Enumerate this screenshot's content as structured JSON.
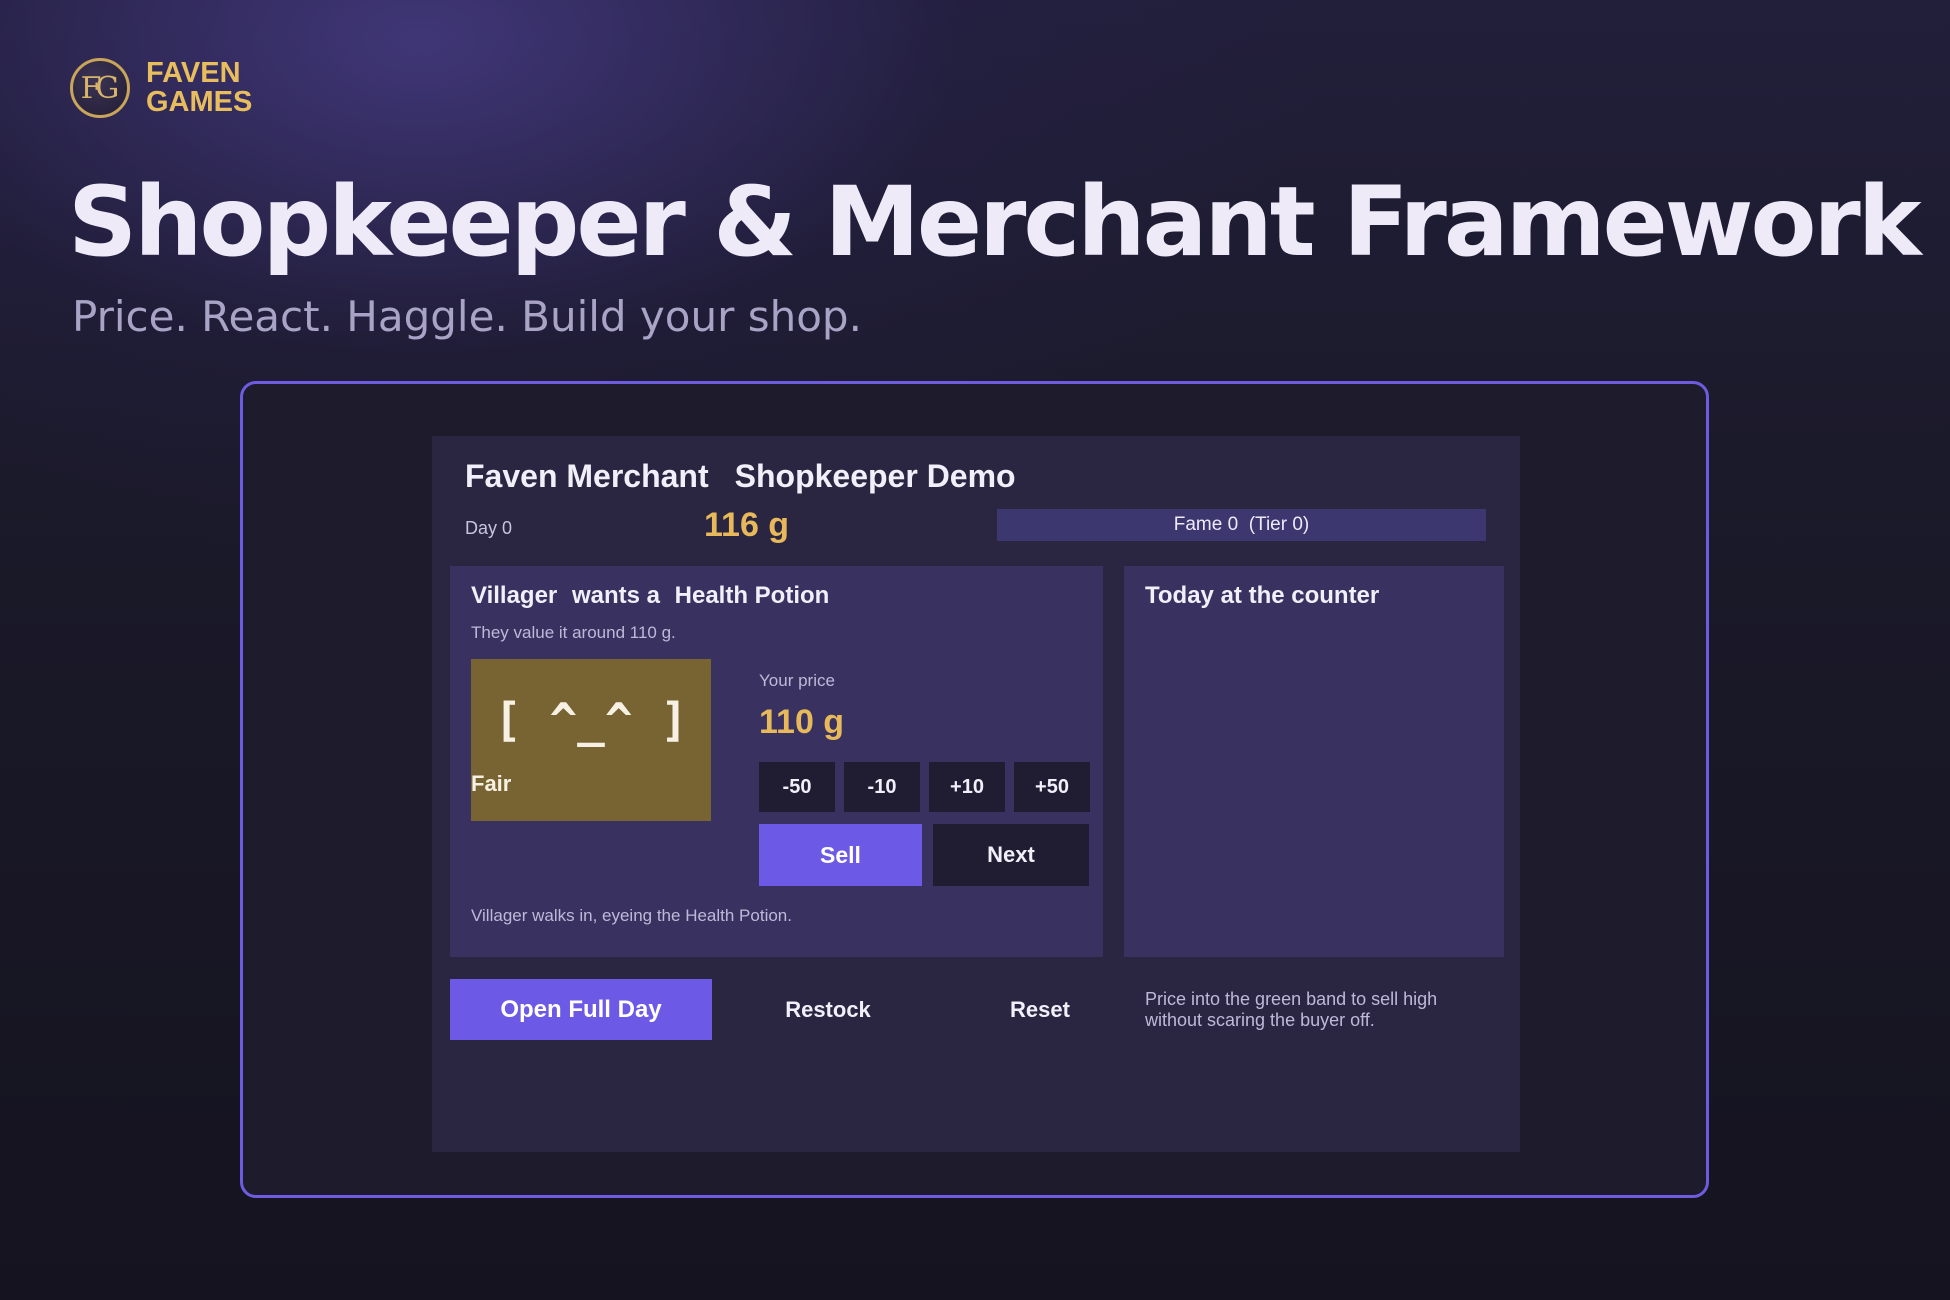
{
  "brand": {
    "logo_monogram": "FG",
    "line1": "FAVEN",
    "line2": "GAMES",
    "color": "#e8bd5e"
  },
  "hero": {
    "title": "Shopkeeper & Merchant Framework",
    "subtitle": "Price. React. Haggle. Build your shop."
  },
  "game": {
    "app_name": "Faven Merchant",
    "screen_title": "Shopkeeper Demo",
    "day_label": "Day 0",
    "gold": "116 g",
    "fame": "Fame 0  (Tier 0)",
    "customer": {
      "name": "Villager",
      "verb": "wants a",
      "item": "Health Potion",
      "value_text": "They value it around 110 g.",
      "mood_face": "[ ^_^ ]",
      "mood_label": "Fair",
      "mood_color": "#786332",
      "price_caption": "Your price",
      "price_value": "110 g",
      "adjust_buttons": [
        "-50",
        "-10",
        "+10",
        "+50"
      ],
      "sell_label": "Sell",
      "next_label": "Next",
      "event_log": "Villager walks in, eyeing the Health Potion."
    },
    "counter": {
      "title": "Today at the counter"
    },
    "actions": {
      "open_day_label": "Open Full Day",
      "restock_label": "Restock",
      "reset_label": "Reset",
      "hint": "Price into the green band to sell high without scaring the buyer off."
    }
  },
  "colors": {
    "accent": "#6c5ae6",
    "gold": "#e7b95a",
    "frame_border": "#6e5ce0",
    "panel": "#2a2540",
    "card": "#393260"
  }
}
